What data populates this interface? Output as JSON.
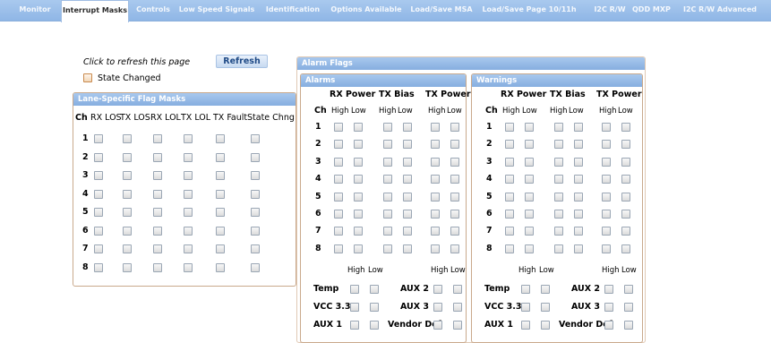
{
  "tabs": [
    {
      "label": "Monitor",
      "active": false
    },
    {
      "label": "Interrupt Masks",
      "active": true
    },
    {
      "label": "Controls",
      "active": false
    },
    {
      "label": "Low Speed Signals",
      "active": false
    },
    {
      "label": "Identification",
      "active": false
    },
    {
      "label": "Options Available",
      "active": false
    },
    {
      "label": "Load/Save MSA",
      "active": false
    },
    {
      "label": "Load/Save Page 10/11h",
      "active": false
    },
    {
      "label": "I2C R/W",
      "active": false
    },
    {
      "label": "QDD MXP",
      "active": false
    },
    {
      "label": "I2C R/W Advanced",
      "active": false
    }
  ],
  "refresh": {
    "label": "Click to refresh this page",
    "button": "Refresh"
  },
  "state_changed": {
    "label": "State Changed"
  },
  "lane_panel": {
    "title": "Lane-Specific Flag Masks",
    "columns": [
      "Ch",
      "RX LOS",
      "TX LOS",
      "RX LOL",
      "TX LOL",
      "TX Fault",
      "State Chng"
    ],
    "channels": [
      "1",
      "2",
      "3",
      "4",
      "5",
      "6",
      "7",
      "8"
    ]
  },
  "alarm_flags": {
    "title": "Alarm Flags",
    "alarms": {
      "title": "Alarms",
      "groups": [
        "RX Power",
        "TX Bias",
        "TX Power"
      ],
      "ch_label": "Ch",
      "high": "High",
      "low": "Low",
      "channels": [
        "1",
        "2",
        "3",
        "4",
        "5",
        "6",
        "7",
        "8"
      ],
      "aux": {
        "high": "High",
        "low": "Low",
        "left": [
          "Temp",
          "VCC 3.3",
          "AUX 1"
        ],
        "right": [
          "AUX 2",
          "AUX 3",
          "Vendor Def"
        ]
      }
    },
    "warnings": {
      "title": "Warnings",
      "groups": [
        "RX Power",
        "TX Bias",
        "TX Power"
      ],
      "ch_label": "Ch",
      "high": "High",
      "low": "Low",
      "channels": [
        "1",
        "2",
        "3",
        "4",
        "5",
        "6",
        "7",
        "8"
      ],
      "aux": {
        "high": "High",
        "low": "Low",
        "left": [
          "Temp",
          "VCC 3.3",
          "AUX 1"
        ],
        "right": [
          "AUX 2",
          "AUX 3",
          "Vendor Def"
        ]
      }
    }
  }
}
